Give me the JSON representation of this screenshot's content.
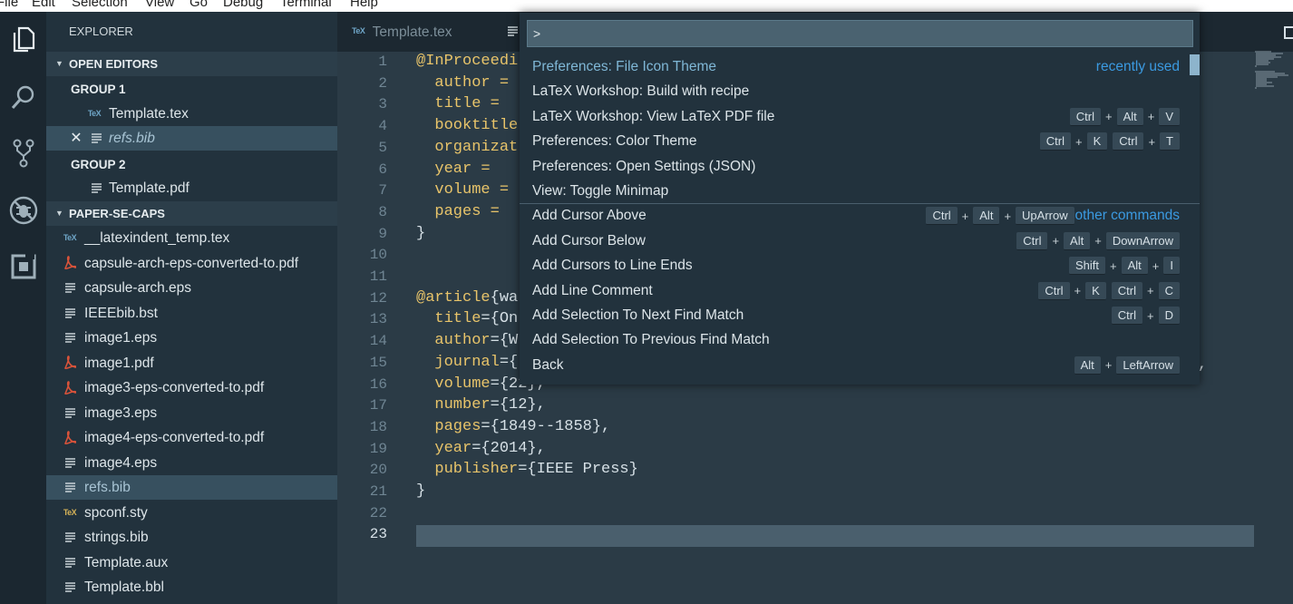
{
  "menubar": {
    "items": [
      "File",
      "Edit",
      "Selection",
      "View",
      "Go",
      "Debug",
      "Terminal",
      "Help"
    ]
  },
  "activity_bar": {
    "icons": [
      "files-icon",
      "search-icon",
      "source-control-icon",
      "debug-icon",
      "extensions-icon"
    ]
  },
  "sidebar": {
    "title": "EXPLORER",
    "open_editors": {
      "label": "OPEN EDITORS",
      "groups": [
        {
          "label": "GROUP 1",
          "files": [
            {
              "name": "Template.tex",
              "icon": "tex"
            },
            {
              "name": "refs.bib",
              "icon": "doc",
              "modified": true
            }
          ]
        },
        {
          "label": "GROUP 2",
          "files": [
            {
              "name": "Template.pdf",
              "icon": "doc"
            }
          ]
        }
      ]
    },
    "folder": {
      "label": "PAPER-SE-CAPS",
      "files": [
        {
          "name": "__latexindent_temp.tex",
          "icon": "tex"
        },
        {
          "name": "capsule-arch-eps-converted-to.pdf",
          "icon": "pdf"
        },
        {
          "name": "capsule-arch.eps",
          "icon": "doc"
        },
        {
          "name": "IEEEbib.bst",
          "icon": "doc"
        },
        {
          "name": "image1.eps",
          "icon": "doc"
        },
        {
          "name": "image1.pdf",
          "icon": "pdf"
        },
        {
          "name": "image3-eps-converted-to.pdf",
          "icon": "pdf"
        },
        {
          "name": "image3.eps",
          "icon": "doc"
        },
        {
          "name": "image4-eps-converted-to.pdf",
          "icon": "pdf"
        },
        {
          "name": "image4.eps",
          "icon": "doc"
        },
        {
          "name": "refs.bib",
          "icon": "doc",
          "selected": true
        },
        {
          "name": "spconf.sty",
          "icon": "tex"
        },
        {
          "name": "strings.bib",
          "icon": "doc"
        },
        {
          "name": "Template.aux",
          "icon": "doc"
        },
        {
          "name": "Template.bbl",
          "icon": "doc"
        }
      ]
    }
  },
  "tabs": [
    {
      "label": "Template.tex",
      "icon": "tex"
    }
  ],
  "editor": {
    "lines": [
      {
        "n": "1",
        "k": "@InProceedi",
        "p": ""
      },
      {
        "n": "2",
        "k": "  author = ",
        "p": ""
      },
      {
        "n": "3",
        "k": "  title = ",
        "p": ""
      },
      {
        "n": "4",
        "k": "  booktitle",
        "p": ""
      },
      {
        "n": "5",
        "k": "  organizat",
        "p": ""
      },
      {
        "n": "6",
        "k": "  year = ",
        "p": ""
      },
      {
        "n": "7",
        "k": "  volume = ",
        "p": ""
      },
      {
        "n": "8",
        "k": "  pages = ",
        "p": ""
      },
      {
        "n": "9",
        "k": "",
        "p": "}"
      },
      {
        "n": "10",
        "k": "",
        "p": ""
      },
      {
        "n": "11",
        "k": "",
        "p": ""
      },
      {
        "n": "12",
        "k": "@article",
        "p": "{wa"
      },
      {
        "n": "13",
        "k": "  title",
        "p": "={On"
      },
      {
        "n": "14",
        "k": "  author",
        "p": "={W"
      },
      {
        "n": "15",
        "k": "  journal",
        "p": "={"
      },
      {
        "n": "16",
        "k": "  volume",
        "p": "={22},"
      },
      {
        "n": "17",
        "k": "  number",
        "p": "={12},"
      },
      {
        "n": "18",
        "k": "  pages",
        "p": "={1849--1858},"
      },
      {
        "n": "19",
        "k": "  year",
        "p": "={2014},"
      },
      {
        "n": "20",
        "k": "  publisher",
        "p": "={IEEE Press}"
      },
      {
        "n": "21",
        "k": "",
        "p": "}"
      },
      {
        "n": "22",
        "k": "",
        "p": ""
      },
      {
        "n": "23",
        "k": "",
        "p": ""
      }
    ],
    "line15_tail": ",",
    "current_line": "23"
  },
  "palette": {
    "input_value": ">",
    "items": [
      {
        "label": "Preferences: File Icon Theme",
        "tag": "recently used",
        "keys": [],
        "highlight": true
      },
      {
        "label": "LaTeX Workshop: Build with recipe",
        "keys": []
      },
      {
        "label": "LaTeX Workshop: View LaTeX PDF file",
        "keys": [
          [
            "Ctrl",
            "Alt",
            "V"
          ]
        ]
      },
      {
        "label": "Preferences: Color Theme",
        "keys": [
          [
            "Ctrl",
            "K"
          ],
          [
            "Ctrl",
            "T"
          ]
        ]
      },
      {
        "label": "Preferences: Open Settings (JSON)",
        "keys": []
      },
      {
        "label": "View: Toggle Minimap",
        "keys": []
      },
      {
        "label": "Add Cursor Above",
        "tag": "other commands",
        "keys": [
          [
            "Ctrl",
            "Alt",
            "UpArrow"
          ]
        ]
      },
      {
        "label": "Add Cursor Below",
        "keys": [
          [
            "Ctrl",
            "Alt",
            "DownArrow"
          ]
        ]
      },
      {
        "label": "Add Cursors to Line Ends",
        "keys": [
          [
            "Shift",
            "Alt",
            "I"
          ]
        ]
      },
      {
        "label": "Add Line Comment",
        "keys": [
          [
            "Ctrl",
            "K"
          ],
          [
            "Ctrl",
            "C"
          ]
        ]
      },
      {
        "label": "Add Selection To Next Find Match",
        "keys": [
          [
            "Ctrl",
            "D"
          ]
        ]
      },
      {
        "label": "Add Selection To Previous Find Match",
        "keys": []
      },
      {
        "label": "Back",
        "keys": [
          [
            "Alt",
            "LeftArrow"
          ]
        ]
      }
    ]
  },
  "colors": {
    "accent": "#3b9ae1",
    "keyword": "#e8c46a",
    "sidebar_bg": "#22323d",
    "editor_bg": "#2b3b46"
  }
}
